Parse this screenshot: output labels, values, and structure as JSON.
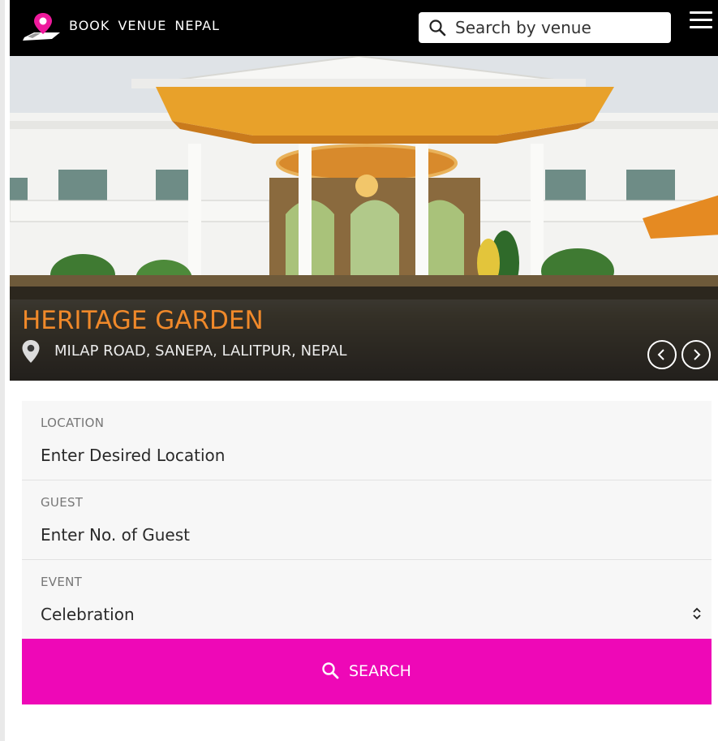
{
  "header": {
    "brand": "BOOK VENUE NEPAL",
    "search_placeholder": "Search by venue"
  },
  "hero": {
    "venue_name": "HERITAGE GARDEN",
    "venue_address": "MILAP ROAD, SANEPA, LALITPUR, NEPAL"
  },
  "form": {
    "location": {
      "label": "LOCATION",
      "placeholder": "Enter Desired Location"
    },
    "guest": {
      "label": "GUEST",
      "placeholder": "Enter No. of Guest"
    },
    "event": {
      "label": "EVENT",
      "selected": "Celebration"
    },
    "search_label": "SEARCH"
  },
  "icons": {
    "logo": "map-pin-logo-icon",
    "search": "search-icon",
    "menu": "hamburger-menu-icon",
    "pin": "location-pin-icon",
    "prev": "chevron-left-icon",
    "next": "chevron-right-icon",
    "caret": "select-updown-icon"
  },
  "colors": {
    "header_bg": "#000000",
    "accent": "#ee08b7",
    "venue_name": "#f0892a"
  }
}
